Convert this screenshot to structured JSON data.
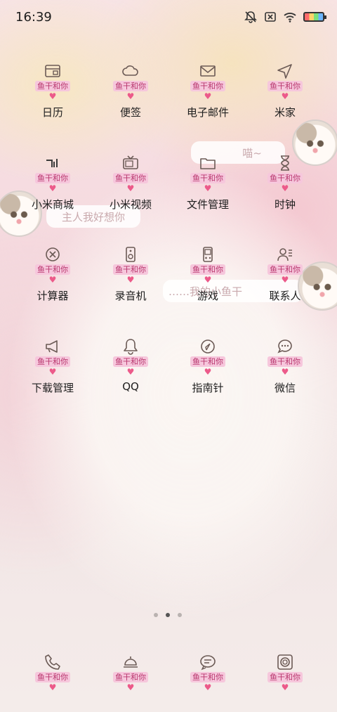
{
  "status_bar": {
    "time": "16:39",
    "icons": [
      "mute-bell-icon",
      "sim-x-icon",
      "wifi-icon",
      "battery-icon"
    ]
  },
  "tag_text": "鱼干和你",
  "apps": [
    {
      "label": "日历",
      "icon": "calendar-card-icon"
    },
    {
      "label": "便签",
      "icon": "cloud-icon"
    },
    {
      "label": "电子邮件",
      "icon": "mail-icon"
    },
    {
      "label": "米家",
      "icon": "send-arrow-icon"
    },
    {
      "label": "小米商城",
      "icon": "store-signal-icon"
    },
    {
      "label": "小米视频",
      "icon": "tv-icon"
    },
    {
      "label": "文件管理",
      "icon": "folder-icon"
    },
    {
      "label": "时钟",
      "icon": "hourglass-icon"
    },
    {
      "label": "计算器",
      "icon": "close-circle-icon"
    },
    {
      "label": "录音机",
      "icon": "speaker-icon"
    },
    {
      "label": "游戏",
      "icon": "gamepad-icon"
    },
    {
      "label": "联系人",
      "icon": "contact-icon"
    },
    {
      "label": "下载管理",
      "icon": "megaphone-icon"
    },
    {
      "label": "QQ",
      "icon": "bell-icon"
    },
    {
      "label": "指南针",
      "icon": "compass-icon"
    },
    {
      "label": "微信",
      "icon": "chat-bubble-icon"
    }
  ],
  "dock": [
    {
      "icon": "phone-icon"
    },
    {
      "icon": "lamp-icon"
    },
    {
      "icon": "message-icon"
    },
    {
      "icon": "camera-icon"
    }
  ],
  "bubbles": {
    "meow": "喵~",
    "miss_master": "主人我好想你",
    "my_fish": "……我的小鱼干"
  },
  "page_indicator": {
    "count": 3,
    "active": 1
  },
  "colors": {
    "tag_bg": "#f6c7dc",
    "tag_text": "#b8366d",
    "heart": "#ec5a8a"
  }
}
